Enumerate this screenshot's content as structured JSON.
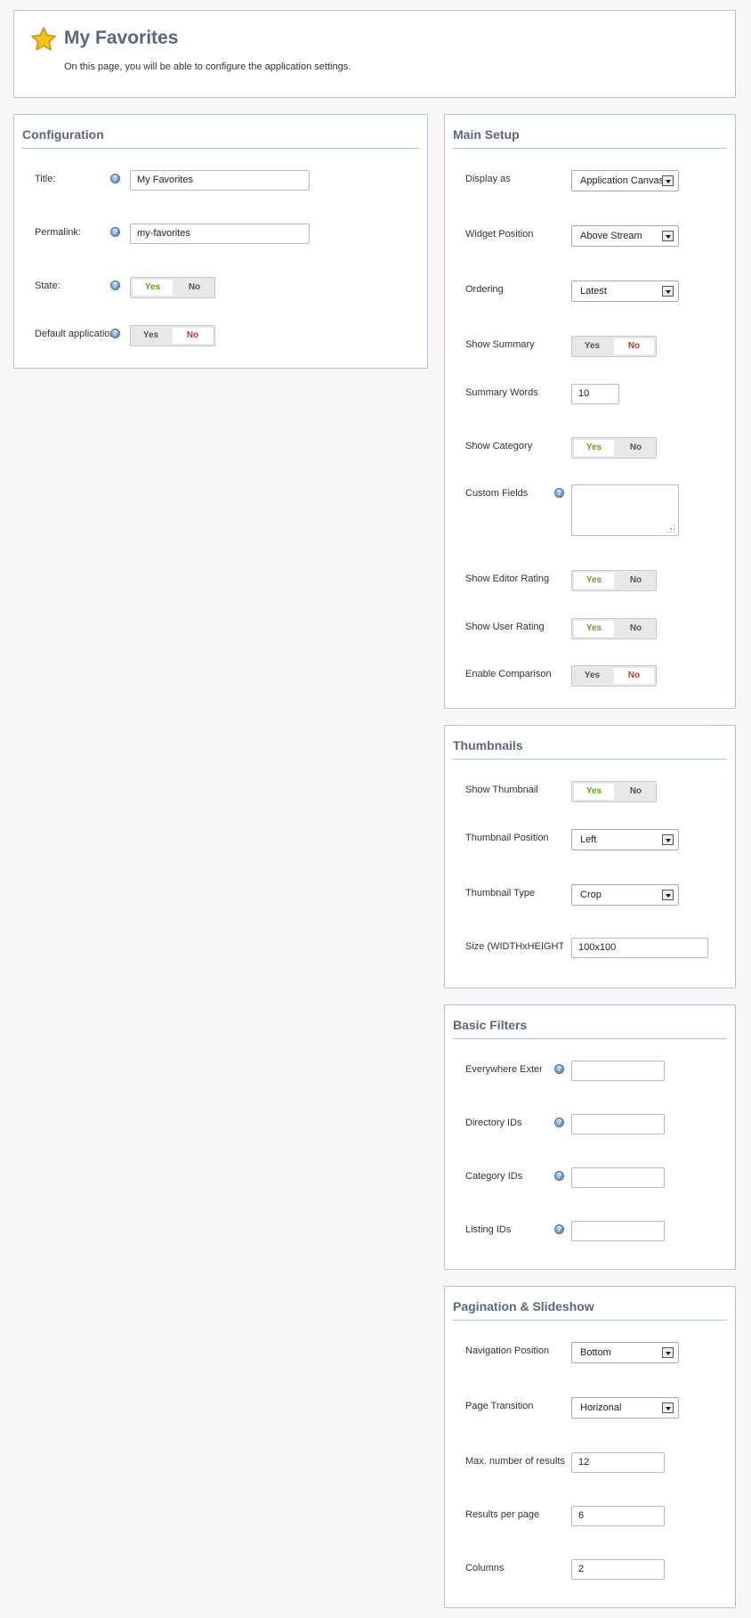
{
  "header": {
    "title": "My Favorites",
    "description": "On this page, you will be able to configure the application settings.",
    "icon": "star-icon"
  },
  "configuration": {
    "heading": "Configuration",
    "title_label": "Title:",
    "title_value": "My Favorites",
    "permalink_label": "Permalink:",
    "permalink_value": "my-favorites",
    "state_label": "State:",
    "default_label": "Default application:"
  },
  "main_setup": {
    "heading": "Main Setup",
    "display_as_label": "Display as",
    "display_as_value": "Application Canvas",
    "widget_position_label": "Widget Position",
    "widget_position_value": "Above Stream",
    "ordering_label": "Ordering",
    "ordering_value": "Latest",
    "show_summary_label": "Show Summary",
    "summary_words_label": "Summary Words",
    "summary_words_value": "10",
    "show_category_label": "Show Category",
    "custom_fields_label": "Custom Fields",
    "show_editor_rating_label": "Show Editor Rating",
    "show_user_rating_label": "Show User Rating",
    "enable_comparison_label": "Enable Comparison"
  },
  "thumbnails": {
    "heading": "Thumbnails",
    "show_thumbnail_label": "Show Thumbnail",
    "thumbnail_position_label": "Thumbnail Position",
    "thumbnail_position_value": "Left",
    "thumbnail_type_label": "Thumbnail Type",
    "thumbnail_type_value": "Crop",
    "size_label": "Size (WIDTHxHEIGHT)",
    "size_value": "100x100"
  },
  "basic_filters": {
    "heading": "Basic Filters",
    "everywhere_label": "Everywhere Extension",
    "directory_label": "Directory IDs",
    "category_label": "Category IDs",
    "listing_label": "Listing IDs"
  },
  "pagination": {
    "heading": "Pagination & Slideshow",
    "navigation_position_label": "Navigation Position",
    "navigation_position_value": "Bottom",
    "page_transition_label": "Page Transition",
    "page_transition_value": "Horizonal",
    "max_results_label": "Max. number of results",
    "max_results_value": "12",
    "results_per_page_label": "Results per page",
    "results_per_page_value": "6",
    "columns_label": "Columns",
    "columns_value": "2"
  },
  "toggle": {
    "yes": "Yes",
    "no": "No"
  },
  "colors": {
    "yes_active": "#5fa11d",
    "no_active": "#c0392b",
    "heading": "#58697d"
  }
}
